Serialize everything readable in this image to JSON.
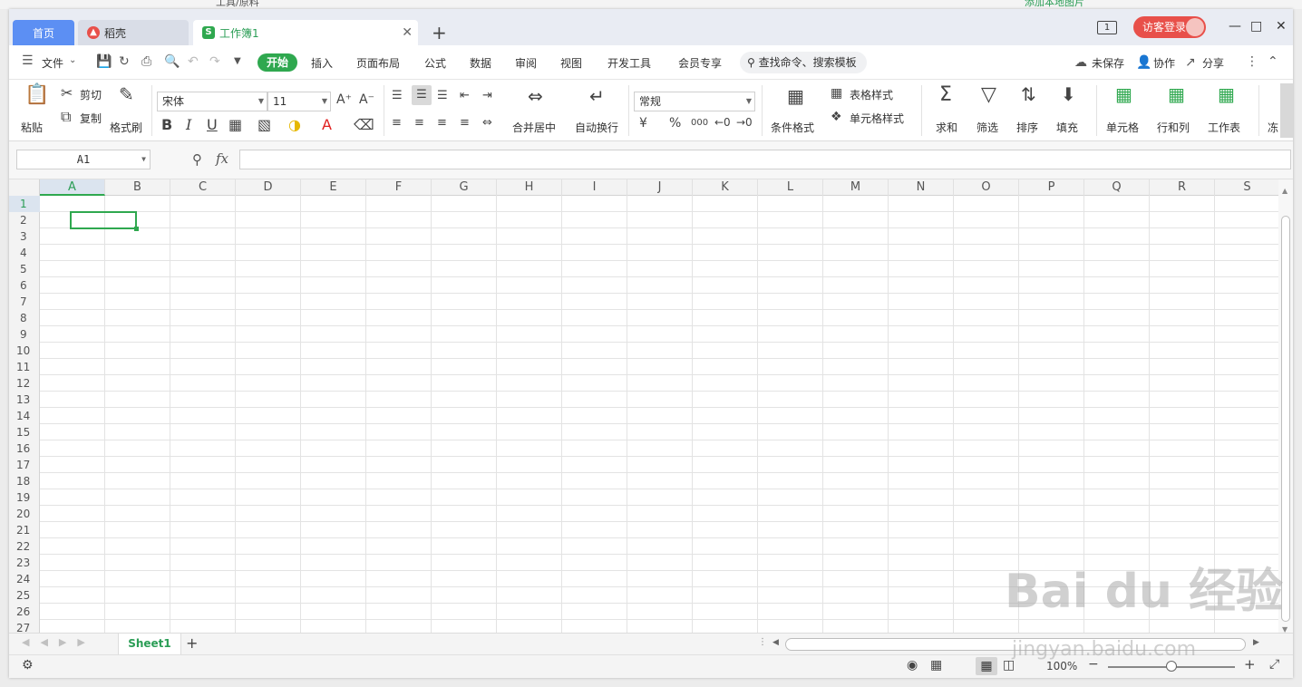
{
  "background": {
    "left_text": "工具/原料",
    "right_text": "添加本地图片"
  },
  "tabs": {
    "home": "首页",
    "daoke": "稻壳",
    "workbook": "工作簿1",
    "new_tab": "+"
  },
  "titlebar": {
    "window_count": "1",
    "login_label": "访客登录"
  },
  "menu": {
    "file": "文件",
    "items": [
      "开始",
      "插入",
      "页面布局",
      "公式",
      "数据",
      "审阅",
      "视图",
      "开发工具",
      "会员专享"
    ],
    "search_placeholder": "查找命令、搜索模板",
    "unsaved": "未保存",
    "collab": "协作",
    "share": "分享"
  },
  "ribbon": {
    "paste": "粘贴",
    "cut": "剪切",
    "copy": "复制",
    "format_painter": "格式刷",
    "font_name": "宋体",
    "font_size": "11",
    "bold": "B",
    "italic": "I",
    "underline": "U",
    "merge_center": "合并居中",
    "wrap_text": "自动换行",
    "number_format": "常规",
    "percent": "%",
    "thousands": "000",
    "conditional_format": "条件格式",
    "table_style": "表格样式",
    "cell_style": "单元格样式",
    "sum": "求和",
    "filter": "筛选",
    "sort": "排序",
    "fill": "填充",
    "cell": "单元格",
    "row_col": "行和列",
    "worksheet": "工作表",
    "freeze": "冻"
  },
  "formula_bar": {
    "name_box": "A1",
    "fx": "fx"
  },
  "grid": {
    "columns": [
      "A",
      "B",
      "C",
      "D",
      "E",
      "F",
      "G",
      "H",
      "I",
      "J",
      "K",
      "L",
      "M",
      "N",
      "O",
      "P",
      "Q",
      "R",
      "S"
    ],
    "rows": [
      "1",
      "2",
      "3",
      "4",
      "5",
      "6",
      "7",
      "8",
      "9",
      "10",
      "11",
      "12",
      "13",
      "14",
      "15",
      "16",
      "17",
      "18",
      "19",
      "20",
      "21",
      "22",
      "23",
      "24",
      "25",
      "26",
      "27"
    ],
    "active_cell": "A1"
  },
  "sheets": [
    "Sheet1"
  ],
  "status": {
    "zoom": "100%"
  },
  "watermark": {
    "brand": "Bai du 经验",
    "url": "jingyan.baidu.com"
  },
  "colors": {
    "accent_green": "#2fa84f",
    "home_tab_blue": "#5c8ff3",
    "login_red": "#e8504a"
  }
}
